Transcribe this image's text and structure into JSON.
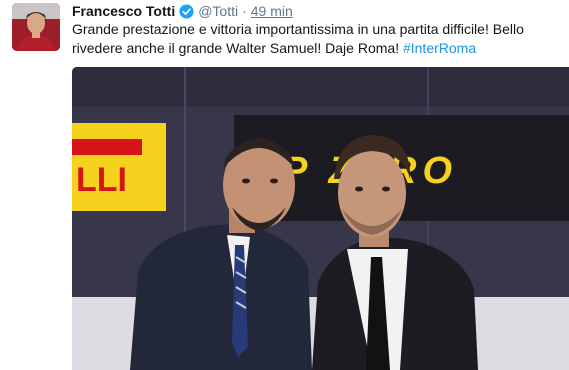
{
  "tweet": {
    "author_name": "Francesco Totti",
    "author_handle": "@Totti",
    "separator": "·",
    "time": "49 min",
    "text": "Grande prestazione e vittoria importantissima in una partita difficile! Bello rivedere anche il grande Walter Samuel! Daje Roma! ",
    "hashtag": "#InterRoma"
  },
  "photo": {
    "sponsor_left": "LLI",
    "sponsor_right": "P ZERO"
  },
  "colors": {
    "link": "#1b95e0",
    "verified": "#1da1f2",
    "sponsor_yellow": "#f4d21e"
  },
  "icons": [
    "verified-badge-icon"
  ]
}
